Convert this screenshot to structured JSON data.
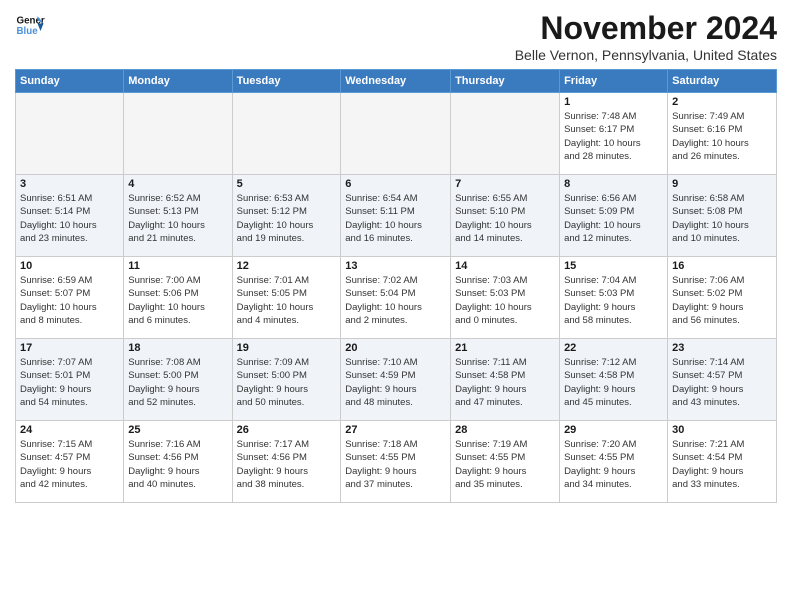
{
  "header": {
    "logo_line1": "General",
    "logo_line2": "Blue",
    "month": "November 2024",
    "location": "Belle Vernon, Pennsylvania, United States"
  },
  "weekdays": [
    "Sunday",
    "Monday",
    "Tuesday",
    "Wednesday",
    "Thursday",
    "Friday",
    "Saturday"
  ],
  "weeks": [
    [
      {
        "day": "",
        "info": ""
      },
      {
        "day": "",
        "info": ""
      },
      {
        "day": "",
        "info": ""
      },
      {
        "day": "",
        "info": ""
      },
      {
        "day": "",
        "info": ""
      },
      {
        "day": "1",
        "info": "Sunrise: 7:48 AM\nSunset: 6:17 PM\nDaylight: 10 hours\nand 28 minutes."
      },
      {
        "day": "2",
        "info": "Sunrise: 7:49 AM\nSunset: 6:16 PM\nDaylight: 10 hours\nand 26 minutes."
      }
    ],
    [
      {
        "day": "3",
        "info": "Sunrise: 6:51 AM\nSunset: 5:14 PM\nDaylight: 10 hours\nand 23 minutes."
      },
      {
        "day": "4",
        "info": "Sunrise: 6:52 AM\nSunset: 5:13 PM\nDaylight: 10 hours\nand 21 minutes."
      },
      {
        "day": "5",
        "info": "Sunrise: 6:53 AM\nSunset: 5:12 PM\nDaylight: 10 hours\nand 19 minutes."
      },
      {
        "day": "6",
        "info": "Sunrise: 6:54 AM\nSunset: 5:11 PM\nDaylight: 10 hours\nand 16 minutes."
      },
      {
        "day": "7",
        "info": "Sunrise: 6:55 AM\nSunset: 5:10 PM\nDaylight: 10 hours\nand 14 minutes."
      },
      {
        "day": "8",
        "info": "Sunrise: 6:56 AM\nSunset: 5:09 PM\nDaylight: 10 hours\nand 12 minutes."
      },
      {
        "day": "9",
        "info": "Sunrise: 6:58 AM\nSunset: 5:08 PM\nDaylight: 10 hours\nand 10 minutes."
      }
    ],
    [
      {
        "day": "10",
        "info": "Sunrise: 6:59 AM\nSunset: 5:07 PM\nDaylight: 10 hours\nand 8 minutes."
      },
      {
        "day": "11",
        "info": "Sunrise: 7:00 AM\nSunset: 5:06 PM\nDaylight: 10 hours\nand 6 minutes."
      },
      {
        "day": "12",
        "info": "Sunrise: 7:01 AM\nSunset: 5:05 PM\nDaylight: 10 hours\nand 4 minutes."
      },
      {
        "day": "13",
        "info": "Sunrise: 7:02 AM\nSunset: 5:04 PM\nDaylight: 10 hours\nand 2 minutes."
      },
      {
        "day": "14",
        "info": "Sunrise: 7:03 AM\nSunset: 5:03 PM\nDaylight: 10 hours\nand 0 minutes."
      },
      {
        "day": "15",
        "info": "Sunrise: 7:04 AM\nSunset: 5:03 PM\nDaylight: 9 hours\nand 58 minutes."
      },
      {
        "day": "16",
        "info": "Sunrise: 7:06 AM\nSunset: 5:02 PM\nDaylight: 9 hours\nand 56 minutes."
      }
    ],
    [
      {
        "day": "17",
        "info": "Sunrise: 7:07 AM\nSunset: 5:01 PM\nDaylight: 9 hours\nand 54 minutes."
      },
      {
        "day": "18",
        "info": "Sunrise: 7:08 AM\nSunset: 5:00 PM\nDaylight: 9 hours\nand 52 minutes."
      },
      {
        "day": "19",
        "info": "Sunrise: 7:09 AM\nSunset: 5:00 PM\nDaylight: 9 hours\nand 50 minutes."
      },
      {
        "day": "20",
        "info": "Sunrise: 7:10 AM\nSunset: 4:59 PM\nDaylight: 9 hours\nand 48 minutes."
      },
      {
        "day": "21",
        "info": "Sunrise: 7:11 AM\nSunset: 4:58 PM\nDaylight: 9 hours\nand 47 minutes."
      },
      {
        "day": "22",
        "info": "Sunrise: 7:12 AM\nSunset: 4:58 PM\nDaylight: 9 hours\nand 45 minutes."
      },
      {
        "day": "23",
        "info": "Sunrise: 7:14 AM\nSunset: 4:57 PM\nDaylight: 9 hours\nand 43 minutes."
      }
    ],
    [
      {
        "day": "24",
        "info": "Sunrise: 7:15 AM\nSunset: 4:57 PM\nDaylight: 9 hours\nand 42 minutes."
      },
      {
        "day": "25",
        "info": "Sunrise: 7:16 AM\nSunset: 4:56 PM\nDaylight: 9 hours\nand 40 minutes."
      },
      {
        "day": "26",
        "info": "Sunrise: 7:17 AM\nSunset: 4:56 PM\nDaylight: 9 hours\nand 38 minutes."
      },
      {
        "day": "27",
        "info": "Sunrise: 7:18 AM\nSunset: 4:55 PM\nDaylight: 9 hours\nand 37 minutes."
      },
      {
        "day": "28",
        "info": "Sunrise: 7:19 AM\nSunset: 4:55 PM\nDaylight: 9 hours\nand 35 minutes."
      },
      {
        "day": "29",
        "info": "Sunrise: 7:20 AM\nSunset: 4:55 PM\nDaylight: 9 hours\nand 34 minutes."
      },
      {
        "day": "30",
        "info": "Sunrise: 7:21 AM\nSunset: 4:54 PM\nDaylight: 9 hours\nand 33 minutes."
      }
    ]
  ]
}
